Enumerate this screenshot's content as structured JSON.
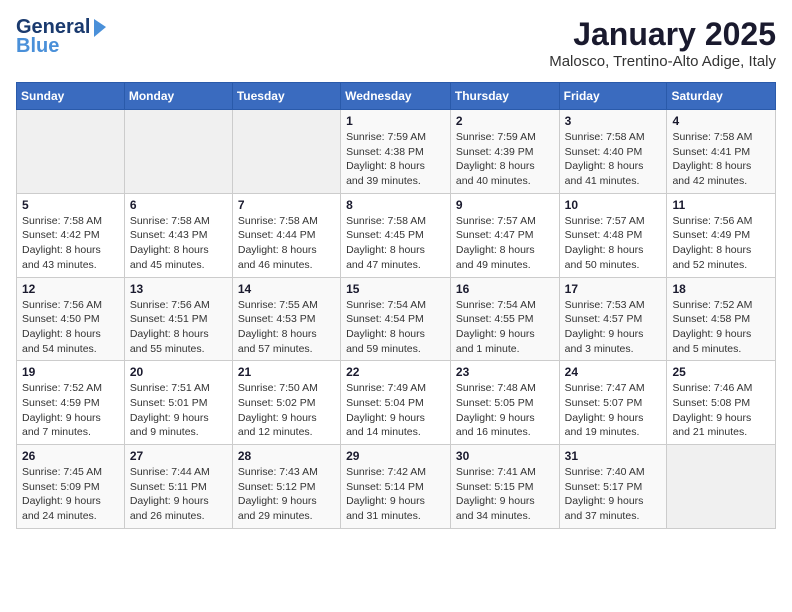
{
  "header": {
    "logo_line1": "General",
    "logo_line2": "Blue",
    "month": "January 2025",
    "location": "Malosco, Trentino-Alto Adige, Italy"
  },
  "weekdays": [
    "Sunday",
    "Monday",
    "Tuesday",
    "Wednesday",
    "Thursday",
    "Friday",
    "Saturday"
  ],
  "weeks": [
    [
      {
        "day": "",
        "content": ""
      },
      {
        "day": "",
        "content": ""
      },
      {
        "day": "",
        "content": ""
      },
      {
        "day": "1",
        "content": "Sunrise: 7:59 AM\nSunset: 4:38 PM\nDaylight: 8 hours and 39 minutes."
      },
      {
        "day": "2",
        "content": "Sunrise: 7:59 AM\nSunset: 4:39 PM\nDaylight: 8 hours and 40 minutes."
      },
      {
        "day": "3",
        "content": "Sunrise: 7:58 AM\nSunset: 4:40 PM\nDaylight: 8 hours and 41 minutes."
      },
      {
        "day": "4",
        "content": "Sunrise: 7:58 AM\nSunset: 4:41 PM\nDaylight: 8 hours and 42 minutes."
      }
    ],
    [
      {
        "day": "5",
        "content": "Sunrise: 7:58 AM\nSunset: 4:42 PM\nDaylight: 8 hours and 43 minutes."
      },
      {
        "day": "6",
        "content": "Sunrise: 7:58 AM\nSunset: 4:43 PM\nDaylight: 8 hours and 45 minutes."
      },
      {
        "day": "7",
        "content": "Sunrise: 7:58 AM\nSunset: 4:44 PM\nDaylight: 8 hours and 46 minutes."
      },
      {
        "day": "8",
        "content": "Sunrise: 7:58 AM\nSunset: 4:45 PM\nDaylight: 8 hours and 47 minutes."
      },
      {
        "day": "9",
        "content": "Sunrise: 7:57 AM\nSunset: 4:47 PM\nDaylight: 8 hours and 49 minutes."
      },
      {
        "day": "10",
        "content": "Sunrise: 7:57 AM\nSunset: 4:48 PM\nDaylight: 8 hours and 50 minutes."
      },
      {
        "day": "11",
        "content": "Sunrise: 7:56 AM\nSunset: 4:49 PM\nDaylight: 8 hours and 52 minutes."
      }
    ],
    [
      {
        "day": "12",
        "content": "Sunrise: 7:56 AM\nSunset: 4:50 PM\nDaylight: 8 hours and 54 minutes."
      },
      {
        "day": "13",
        "content": "Sunrise: 7:56 AM\nSunset: 4:51 PM\nDaylight: 8 hours and 55 minutes."
      },
      {
        "day": "14",
        "content": "Sunrise: 7:55 AM\nSunset: 4:53 PM\nDaylight: 8 hours and 57 minutes."
      },
      {
        "day": "15",
        "content": "Sunrise: 7:54 AM\nSunset: 4:54 PM\nDaylight: 8 hours and 59 minutes."
      },
      {
        "day": "16",
        "content": "Sunrise: 7:54 AM\nSunset: 4:55 PM\nDaylight: 9 hours and 1 minute."
      },
      {
        "day": "17",
        "content": "Sunrise: 7:53 AM\nSunset: 4:57 PM\nDaylight: 9 hours and 3 minutes."
      },
      {
        "day": "18",
        "content": "Sunrise: 7:52 AM\nSunset: 4:58 PM\nDaylight: 9 hours and 5 minutes."
      }
    ],
    [
      {
        "day": "19",
        "content": "Sunrise: 7:52 AM\nSunset: 4:59 PM\nDaylight: 9 hours and 7 minutes."
      },
      {
        "day": "20",
        "content": "Sunrise: 7:51 AM\nSunset: 5:01 PM\nDaylight: 9 hours and 9 minutes."
      },
      {
        "day": "21",
        "content": "Sunrise: 7:50 AM\nSunset: 5:02 PM\nDaylight: 9 hours and 12 minutes."
      },
      {
        "day": "22",
        "content": "Sunrise: 7:49 AM\nSunset: 5:04 PM\nDaylight: 9 hours and 14 minutes."
      },
      {
        "day": "23",
        "content": "Sunrise: 7:48 AM\nSunset: 5:05 PM\nDaylight: 9 hours and 16 minutes."
      },
      {
        "day": "24",
        "content": "Sunrise: 7:47 AM\nSunset: 5:07 PM\nDaylight: 9 hours and 19 minutes."
      },
      {
        "day": "25",
        "content": "Sunrise: 7:46 AM\nSunset: 5:08 PM\nDaylight: 9 hours and 21 minutes."
      }
    ],
    [
      {
        "day": "26",
        "content": "Sunrise: 7:45 AM\nSunset: 5:09 PM\nDaylight: 9 hours and 24 minutes."
      },
      {
        "day": "27",
        "content": "Sunrise: 7:44 AM\nSunset: 5:11 PM\nDaylight: 9 hours and 26 minutes."
      },
      {
        "day": "28",
        "content": "Sunrise: 7:43 AM\nSunset: 5:12 PM\nDaylight: 9 hours and 29 minutes."
      },
      {
        "day": "29",
        "content": "Sunrise: 7:42 AM\nSunset: 5:14 PM\nDaylight: 9 hours and 31 minutes."
      },
      {
        "day": "30",
        "content": "Sunrise: 7:41 AM\nSunset: 5:15 PM\nDaylight: 9 hours and 34 minutes."
      },
      {
        "day": "31",
        "content": "Sunrise: 7:40 AM\nSunset: 5:17 PM\nDaylight: 9 hours and 37 minutes."
      },
      {
        "day": "",
        "content": ""
      }
    ]
  ]
}
